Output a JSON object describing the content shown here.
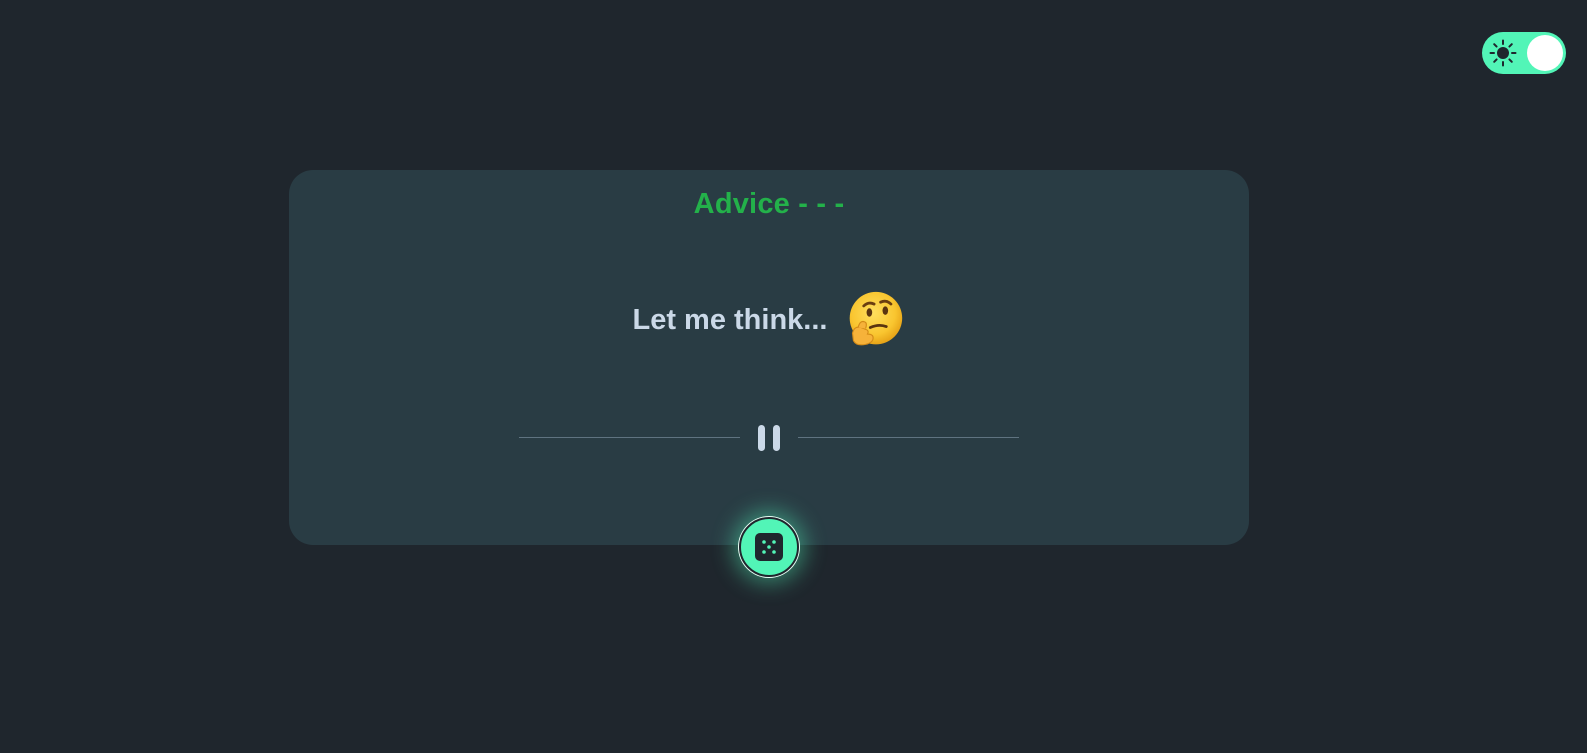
{
  "theme_toggle": {
    "icon": "sun-icon",
    "state": "on",
    "accent_color": "#52f5b7"
  },
  "card": {
    "title": "Advice - - -",
    "title_color": "#23b14a",
    "advice_text": "Let me think...",
    "emoji": "thinking-face-icon",
    "divider_icon": "pause-icon"
  },
  "generate_button": {
    "icon": "dice-icon",
    "color": "#52f5b7"
  },
  "colors": {
    "background": "#1f262d",
    "card": "#293c44",
    "text": "#cbd9e8"
  }
}
